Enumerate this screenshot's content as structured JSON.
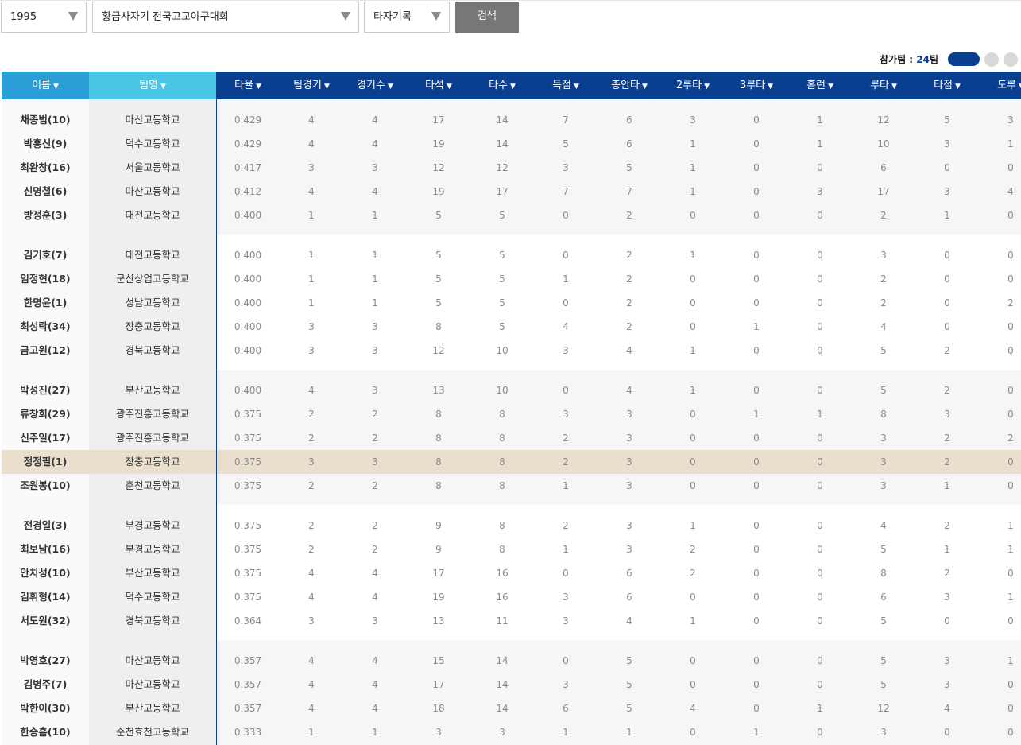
{
  "filters": {
    "year": "1995",
    "tournament": "황금사자기 전국고교야구대회",
    "record_type": "타자기록",
    "search_label": "검색"
  },
  "teams_count": {
    "label": "참가팀 : ",
    "value": "24",
    "suffix": "팀"
  },
  "columns": [
    "이름",
    "팀명",
    "타율",
    "팀경기",
    "경기수",
    "타석",
    "타수",
    "득점",
    "총안타",
    "2루타",
    "3루타",
    "홈런",
    "루타",
    "타점",
    "도루"
  ],
  "highlight_row": 13,
  "rows": [
    [
      "채종범(10)",
      "마산고등학교",
      "0.429",
      "4",
      "4",
      "17",
      "14",
      "7",
      "6",
      "3",
      "0",
      "1",
      "12",
      "5",
      "3"
    ],
    [
      "박흥신(9)",
      "덕수고등학교",
      "0.429",
      "4",
      "4",
      "19",
      "14",
      "5",
      "6",
      "1",
      "0",
      "1",
      "10",
      "3",
      "1"
    ],
    [
      "최완창(16)",
      "서울고등학교",
      "0.417",
      "3",
      "3",
      "12",
      "12",
      "3",
      "5",
      "1",
      "0",
      "0",
      "6",
      "0",
      "0"
    ],
    [
      "신명철(6)",
      "마산고등학교",
      "0.412",
      "4",
      "4",
      "19",
      "17",
      "7",
      "7",
      "1",
      "0",
      "3",
      "17",
      "3",
      "4"
    ],
    [
      "방정훈(3)",
      "대전고등학교",
      "0.400",
      "1",
      "1",
      "5",
      "5",
      "0",
      "2",
      "0",
      "0",
      "0",
      "2",
      "1",
      "0"
    ],
    [
      "김기호(7)",
      "대전고등학교",
      "0.400",
      "1",
      "1",
      "5",
      "5",
      "0",
      "2",
      "1",
      "0",
      "0",
      "3",
      "0",
      "0"
    ],
    [
      "임정현(18)",
      "군산상업고등학교",
      "0.400",
      "1",
      "1",
      "5",
      "5",
      "1",
      "2",
      "0",
      "0",
      "0",
      "2",
      "0",
      "0"
    ],
    [
      "한명윤(1)",
      "성남고등학교",
      "0.400",
      "1",
      "1",
      "5",
      "5",
      "0",
      "2",
      "0",
      "0",
      "0",
      "2",
      "0",
      "2"
    ],
    [
      "최성락(34)",
      "장충고등학교",
      "0.400",
      "3",
      "3",
      "8",
      "5",
      "4",
      "2",
      "0",
      "1",
      "0",
      "4",
      "0",
      "0"
    ],
    [
      "금고원(12)",
      "경북고등학교",
      "0.400",
      "3",
      "3",
      "12",
      "10",
      "3",
      "4",
      "1",
      "0",
      "0",
      "5",
      "2",
      "0"
    ],
    [
      "박성진(27)",
      "부산고등학교",
      "0.400",
      "4",
      "3",
      "13",
      "10",
      "0",
      "4",
      "1",
      "0",
      "0",
      "5",
      "2",
      "0"
    ],
    [
      "류창희(29)",
      "광주진흥고등학교",
      "0.375",
      "2",
      "2",
      "8",
      "8",
      "3",
      "3",
      "0",
      "1",
      "1",
      "8",
      "3",
      "0"
    ],
    [
      "신주일(17)",
      "광주진흥고등학교",
      "0.375",
      "2",
      "2",
      "8",
      "8",
      "2",
      "3",
      "0",
      "0",
      "0",
      "3",
      "2",
      "2"
    ],
    [
      "정정필(1)",
      "장충고등학교",
      "0.375",
      "3",
      "3",
      "8",
      "8",
      "2",
      "3",
      "0",
      "0",
      "0",
      "3",
      "2",
      "0"
    ],
    [
      "조원봉(10)",
      "춘천고등학교",
      "0.375",
      "2",
      "2",
      "8",
      "8",
      "1",
      "3",
      "0",
      "0",
      "0",
      "3",
      "1",
      "0"
    ],
    [
      "전경일(3)",
      "부경고등학교",
      "0.375",
      "2",
      "2",
      "9",
      "8",
      "2",
      "3",
      "1",
      "0",
      "0",
      "4",
      "2",
      "1"
    ],
    [
      "최보남(16)",
      "부경고등학교",
      "0.375",
      "2",
      "2",
      "9",
      "8",
      "1",
      "3",
      "2",
      "0",
      "0",
      "5",
      "1",
      "1"
    ],
    [
      "안치성(10)",
      "부산고등학교",
      "0.375",
      "4",
      "4",
      "17",
      "16",
      "0",
      "6",
      "2",
      "0",
      "0",
      "8",
      "2",
      "0"
    ],
    [
      "김휘형(14)",
      "덕수고등학교",
      "0.375",
      "4",
      "4",
      "19",
      "16",
      "3",
      "6",
      "0",
      "0",
      "0",
      "6",
      "3",
      "1"
    ],
    [
      "서도원(32)",
      "경북고등학교",
      "0.364",
      "3",
      "3",
      "13",
      "11",
      "3",
      "4",
      "1",
      "0",
      "0",
      "5",
      "0",
      "0"
    ],
    [
      "박영호(27)",
      "마산고등학교",
      "0.357",
      "4",
      "4",
      "15",
      "14",
      "0",
      "5",
      "0",
      "0",
      "0",
      "5",
      "3",
      "1"
    ],
    [
      "김병주(7)",
      "마산고등학교",
      "0.357",
      "4",
      "4",
      "17",
      "14",
      "3",
      "5",
      "0",
      "0",
      "0",
      "5",
      "3",
      "0"
    ],
    [
      "박한이(30)",
      "부산고등학교",
      "0.357",
      "4",
      "4",
      "18",
      "14",
      "6",
      "5",
      "4",
      "0",
      "1",
      "12",
      "4",
      "0"
    ],
    [
      "한승흠(10)",
      "순천효천고등학교",
      "0.333",
      "1",
      "1",
      "3",
      "3",
      "1",
      "1",
      "0",
      "1",
      "0",
      "3",
      "0",
      "0"
    ]
  ]
}
